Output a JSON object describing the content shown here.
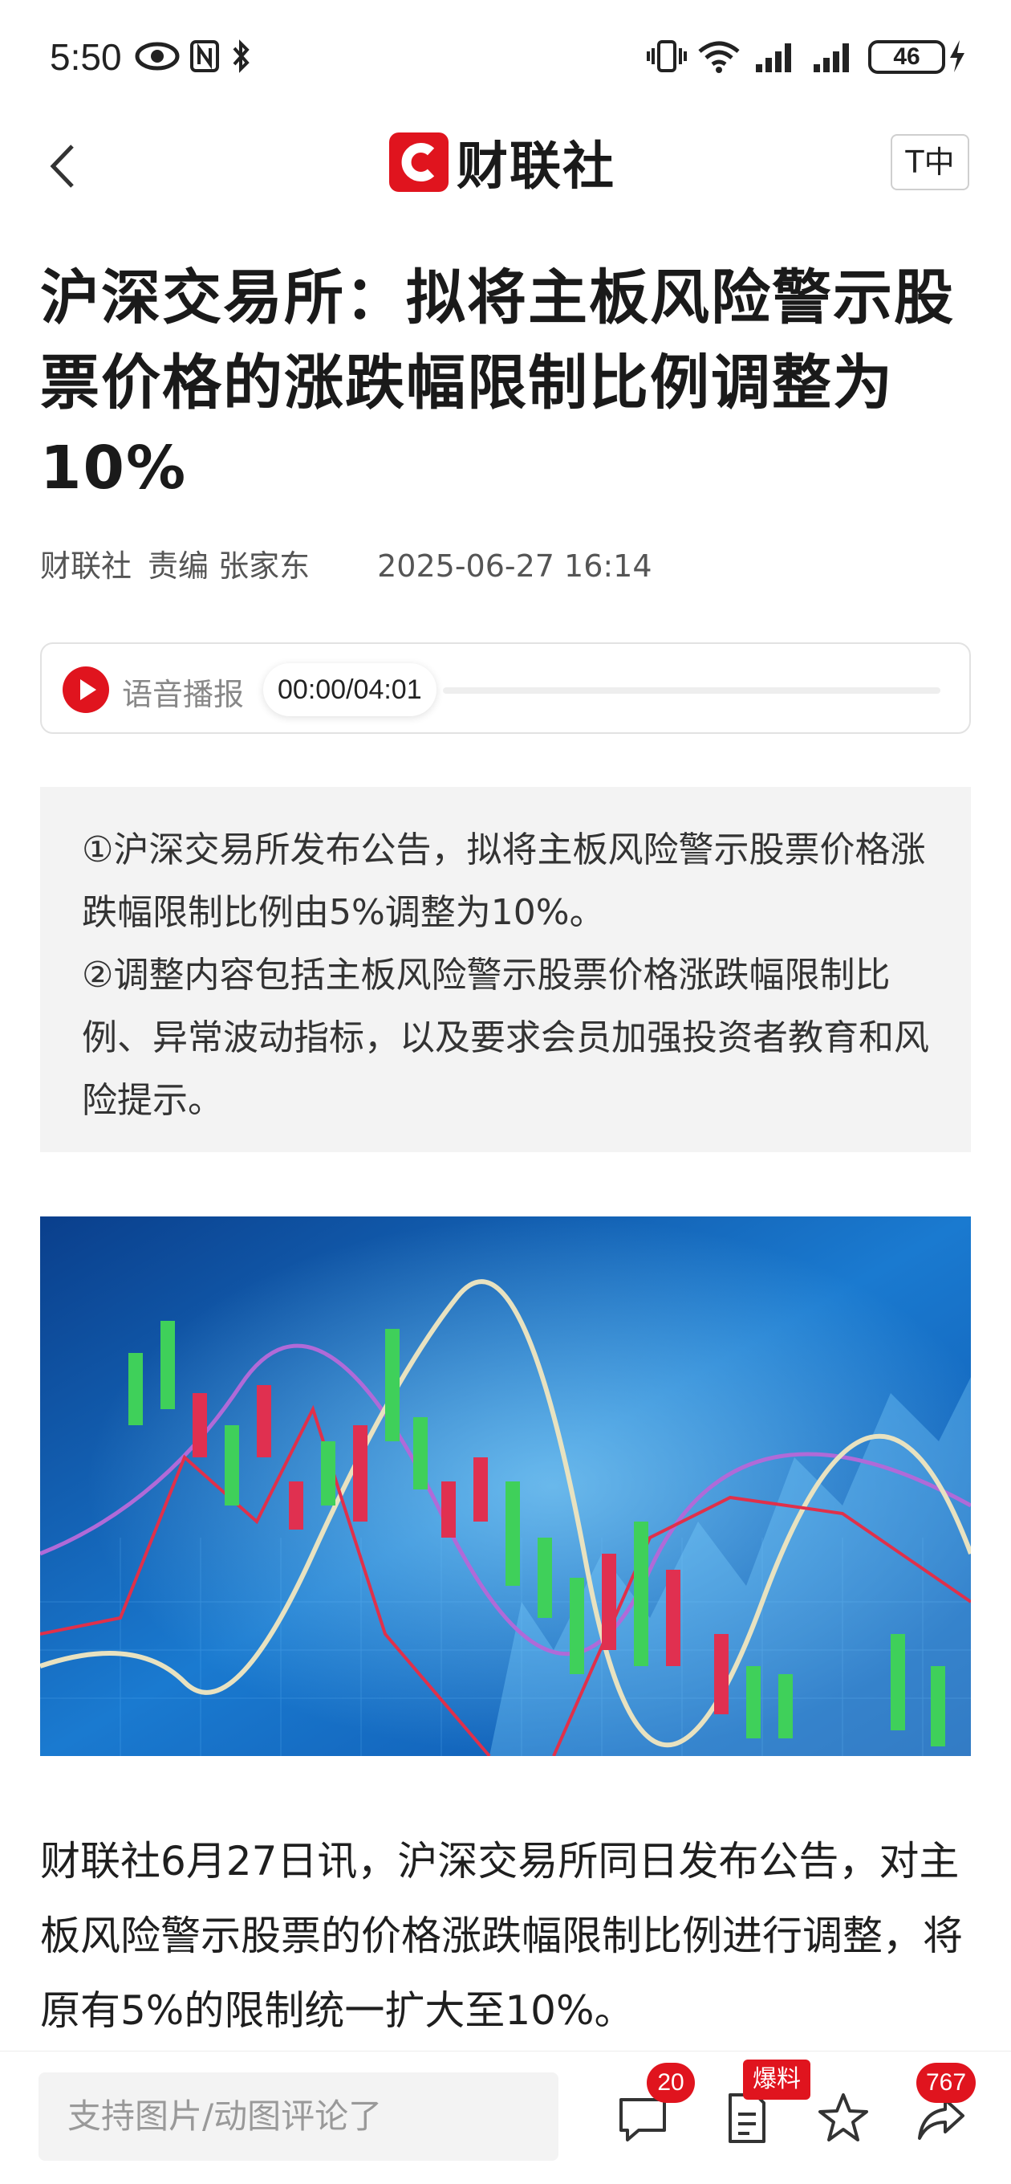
{
  "status_bar": {
    "time": "5:50",
    "battery": "46"
  },
  "navbar": {
    "brand": "财联社",
    "font_toggle": "T中"
  },
  "article": {
    "title": "沪深交易所：拟将主板风险警示股票价格的涨跌幅限制比例调整为10%",
    "meta": {
      "source": "财联社",
      "editor": "责编 张家东",
      "date": "2025-06-27 16:14"
    },
    "audio": {
      "label": "语音播报",
      "time": "00:00/04:01"
    },
    "summary": [
      "①沪深交易所发布公告，拟将主板风险警示股票价格涨跌幅限制比例由5%调整为10%。",
      "②调整内容包括主板风险警示股票价格涨跌幅限制比例、异常波动指标，以及要求会员加强投资者教育和风险提示。"
    ],
    "body": "财联社6月27日讯，沪深交易所同日发布公告，对主板风险警示股票的价格涨跌幅限制比例进行调整，将原有5%的限制统一扩大至10%。"
  },
  "bottom_bar": {
    "comment_placeholder": "支持图片/动图评论了",
    "comment_count": "20",
    "report_badge": "爆料",
    "share_count": "767"
  },
  "colors": {
    "brand_red": "#e0141e",
    "summary_bg": "#f3f3f3"
  }
}
